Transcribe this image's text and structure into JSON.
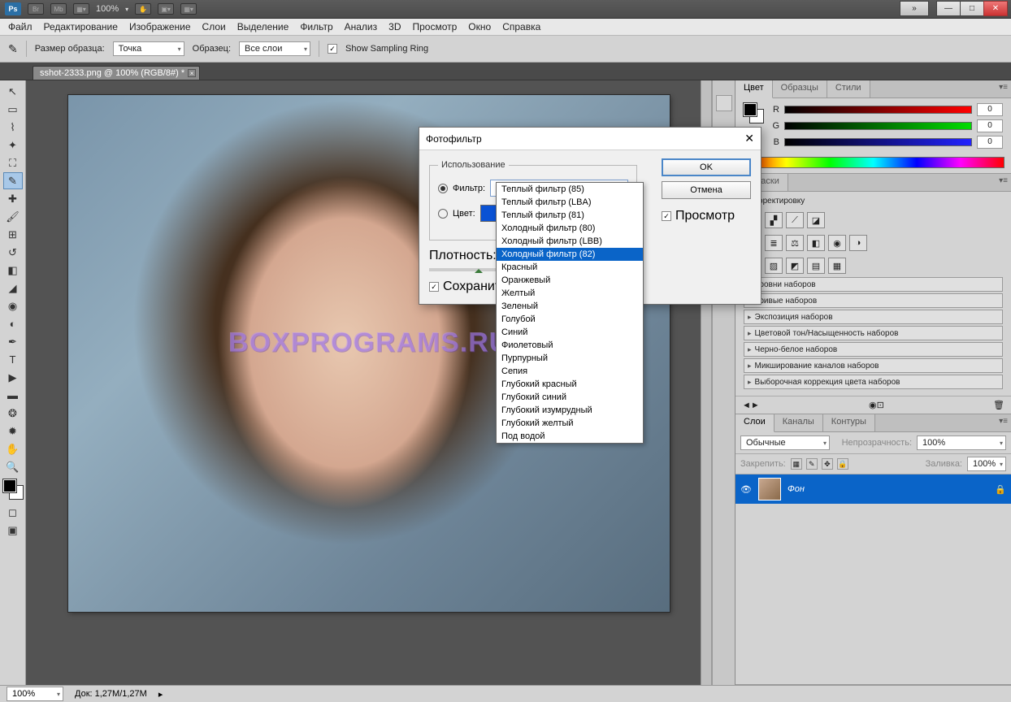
{
  "app": {
    "zoom_label": "100%"
  },
  "menu": [
    "Файл",
    "Редактирование",
    "Изображение",
    "Слои",
    "Выделение",
    "Фильтр",
    "Анализ",
    "3D",
    "Просмотр",
    "Окно",
    "Справка"
  ],
  "options": {
    "sample_size_label": "Размер образца:",
    "sample_size_value": "Точка",
    "sample_label": "Образец:",
    "sample_value": "Все слои",
    "show_ring": "Show Sampling Ring"
  },
  "document": {
    "tab_title": "sshot-2333.png @ 100% (RGB/8#) *"
  },
  "color_panel": {
    "tabs": [
      "Цвет",
      "Образцы",
      "Стили"
    ],
    "channels": [
      {
        "label": "R",
        "value": "0"
      },
      {
        "label": "G",
        "value": "0"
      },
      {
        "label": "B",
        "value": "0"
      }
    ]
  },
  "adjustments_panel": {
    "title_partial": "ь корректировку",
    "tab_masks": "Маски",
    "presets": [
      "Уровни наборов",
      "Кривые наборов",
      "Экспозиция наборов",
      "Цветовой тон/Насыщенность наборов",
      "Черно-белое наборов",
      "Микширование каналов наборов",
      "Выборочная коррекция цвета наборов"
    ]
  },
  "layers_panel": {
    "tabs": [
      "Слои",
      "Каналы",
      "Контуры"
    ],
    "blend_mode": "Обычные",
    "opacity_label": "Непрозрачность:",
    "opacity_value": "100%",
    "lock_label": "Закрепить:",
    "fill_label": "Заливка:",
    "fill_value": "100%",
    "layer_name": "Фон"
  },
  "status": {
    "zoom": "100%",
    "doc_info": "Док: 1,27M/1,27M"
  },
  "dialog": {
    "title": "Фотофильтр",
    "group": "Использование",
    "filter_label": "Фильтр:",
    "filter_value": "Холодный фильтр (80)",
    "color_label": "Цвет:",
    "density_label": "Плотность:",
    "preserve_label": "Сохранить с",
    "ok": "OK",
    "cancel": "Отмена",
    "preview": "Просмотр",
    "options": [
      "Теплый фильтр (85)",
      "Теплый фильтр (LBA)",
      "Теплый фильтр (81)",
      "Холодный фильтр (80)",
      "Холодный фильтр (LBB)",
      "Холодный фильтр (82)",
      "Красный",
      "Оранжевый",
      "Желтый",
      "Зеленый",
      "Голубой",
      "Синий",
      "Фиолетовый",
      "Пурпурный",
      "Сепия",
      "Глубокий красный",
      "Глубокий синий",
      "Глубокий изумрудный",
      "Глубокий желтый",
      "Под водой"
    ],
    "selected_index": 5
  },
  "watermark": "BOXPROGRAMS.RU"
}
